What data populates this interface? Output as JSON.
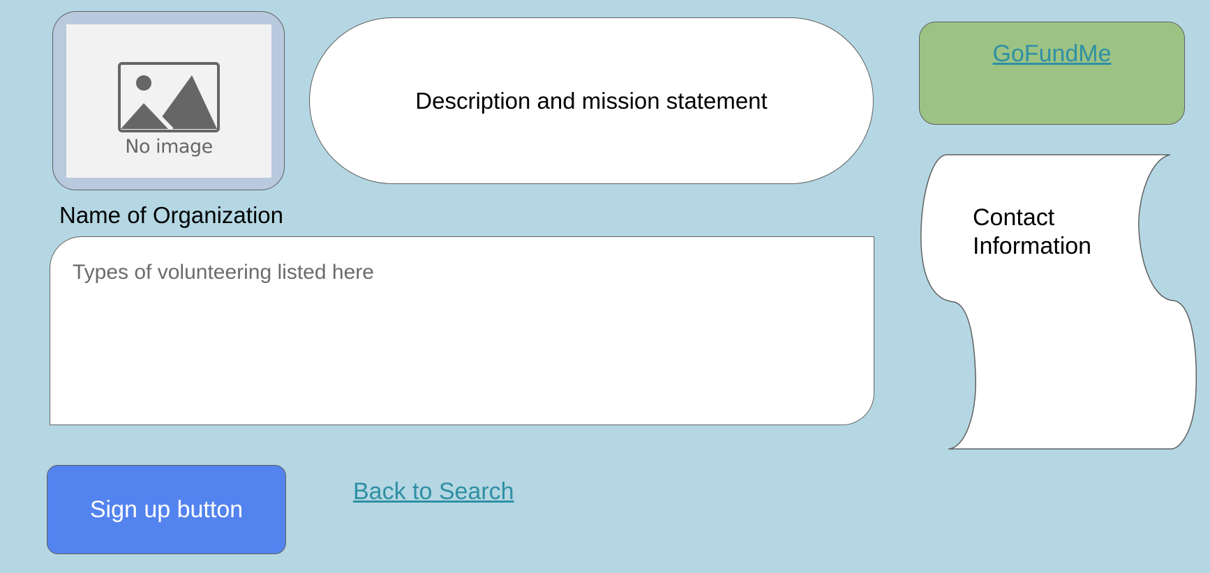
{
  "logo": {
    "placeholder_text": "No image",
    "icon": "image-placeholder-icon"
  },
  "mission": {
    "text": "Description and mission statement"
  },
  "donate": {
    "link_label": "GoFundMe"
  },
  "organization": {
    "name": "Name of Organization"
  },
  "volunteering": {
    "placeholder": "Types of volunteering listed here"
  },
  "contact": {
    "line1": "Contact",
    "line2": "Information"
  },
  "actions": {
    "signup_label": "Sign up button",
    "back_label": "Back to Search"
  },
  "colors": {
    "background": "#b4d7e3",
    "signup_button": "#5383ee",
    "donate_box": "#9cc384",
    "link": "#2f8fa4",
    "logo_frame": "#b9c9de"
  }
}
